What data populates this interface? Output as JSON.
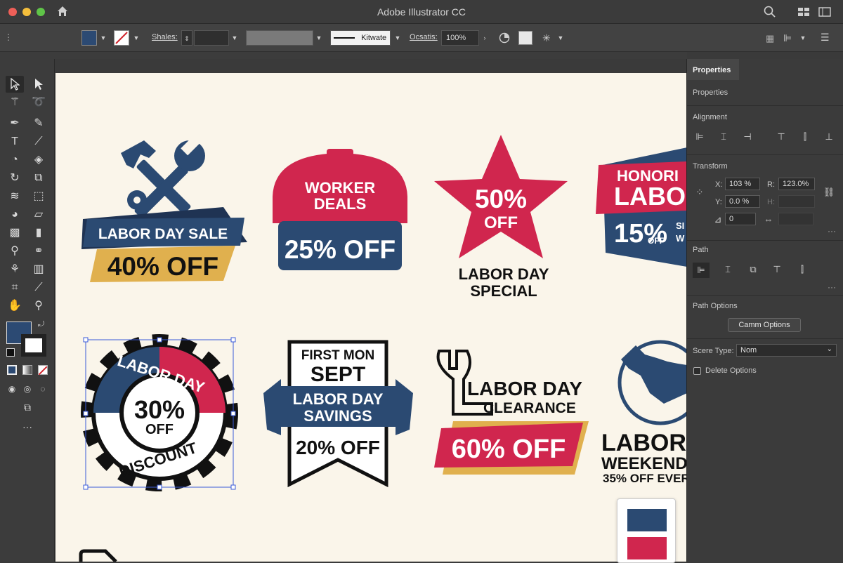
{
  "window": {
    "title": "Adobe Illustrator CC"
  },
  "control_bar": {
    "shapes_label": "Shales:",
    "stroke_style": "Kitwate",
    "opacity_label": "Ocsatis:",
    "opacity_value": "100%"
  },
  "properties_panel": {
    "tab": "Properties",
    "subtitle": "Properties",
    "alignment_label": "Alignment",
    "transform_label": "Transform",
    "x_label": "X:",
    "x_value": "103 %",
    "y_label": "Y:",
    "y_value": "0.0 %",
    "r_label": "R:",
    "r_value": "123.0%",
    "h_label": "H:",
    "angle_value": "0",
    "path_label": "Path",
    "path_options_label": "Path Options",
    "camm_options_button": "Camm Options",
    "scere_type_label": "Scere Type:",
    "scere_type_value": "Nom",
    "delete_options_label": "Delete Options"
  },
  "badges": [
    {
      "line1": "LABOR DAY SALE",
      "line2": "40% OFF"
    },
    {
      "line1": "WORKER",
      "line2": "DEALS",
      "line3": "25% OFF"
    },
    {
      "line1": "50%",
      "line2": "OFF",
      "line3": "LABOR DAY",
      "line4": "SPECIAL"
    },
    {
      "line1": "HONORI",
      "line2": "LABO",
      "line3": "15%",
      "line4": "OFF",
      "line5": "SI",
      "line6": "W"
    },
    {
      "line1": "LABOR DAY",
      "line2": "30%",
      "line3": "OFF",
      "line4": "DISCOUNT"
    },
    {
      "line1": "FIRST MON",
      "line2": "SEPT",
      "line3": "LABOR DAY",
      "line4": "SAVINGS",
      "line5": "20% OFF"
    },
    {
      "line1": "LABOR DAY",
      "line2": "CLEARANCE",
      "line3": "60% OFF"
    },
    {
      "line1": "LABOR",
      "line2": "WEEKEND",
      "line3": "35% OFF EVER"
    }
  ],
  "colors": {
    "navy": "#2b4a72",
    "red": "#d0264e",
    "gold": "#e0b04e",
    "fill_swatch": "#2c4a73",
    "paper": "#faf5ea"
  }
}
